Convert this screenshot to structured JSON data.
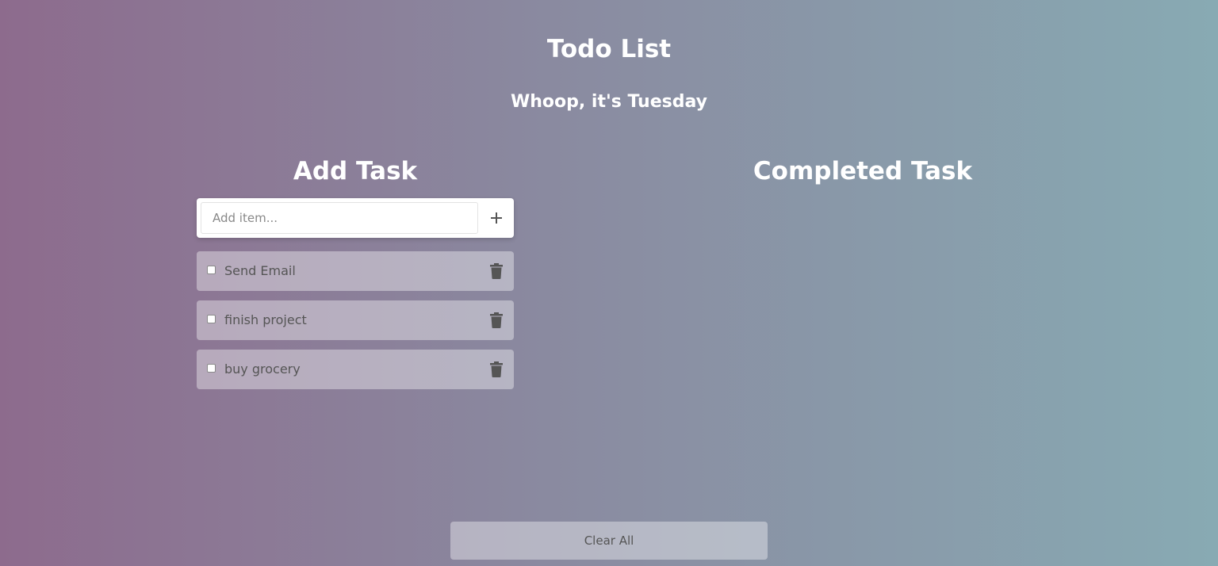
{
  "header": {
    "title": "Todo List",
    "day_message": "Whoop, it's Tuesday"
  },
  "add_section": {
    "title": "Add Task",
    "input_placeholder": "Add item...",
    "input_value": "",
    "add_icon": "plus-icon"
  },
  "completed_section": {
    "title": "Completed Task"
  },
  "tasks": [
    {
      "label": "Send Email",
      "checked": false,
      "delete_icon": "trash-icon"
    },
    {
      "label": "finish project",
      "checked": false,
      "delete_icon": "trash-icon"
    },
    {
      "label": "buy grocery",
      "checked": false,
      "delete_icon": "trash-icon"
    }
  ],
  "footer": {
    "clear_label": "Clear All"
  },
  "colors": {
    "background_start": "#8d6b8d",
    "background_end": "#88aab3",
    "heading_text": "#ffffff",
    "task_text": "#555555"
  }
}
